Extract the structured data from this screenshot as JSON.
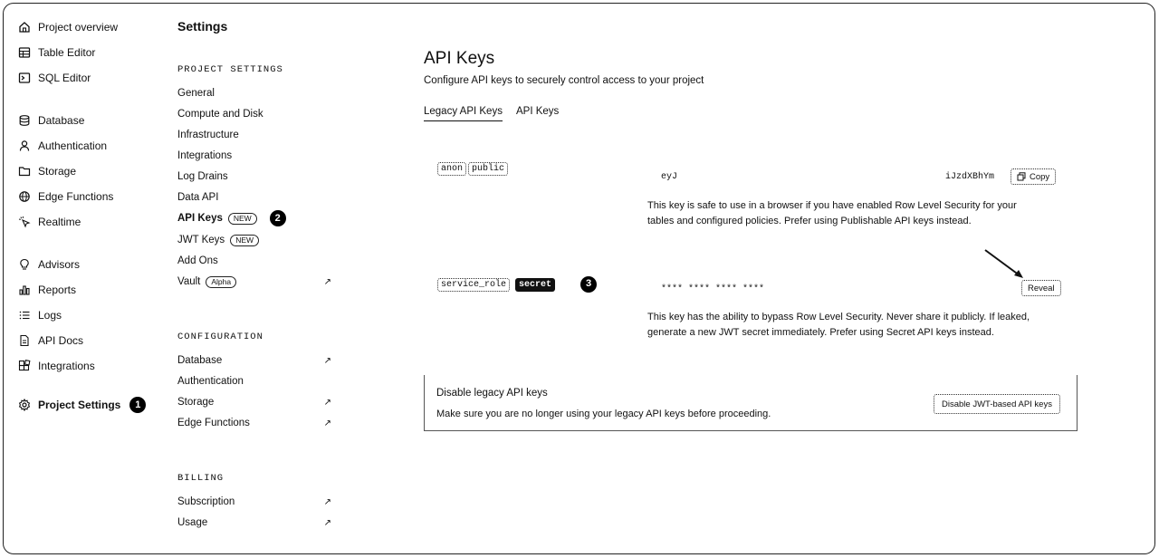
{
  "nav": {
    "items": [
      {
        "label": "Project overview"
      },
      {
        "label": "Table Editor"
      },
      {
        "label": "SQL Editor"
      },
      {
        "label": "Database"
      },
      {
        "label": "Authentication"
      },
      {
        "label": "Storage"
      },
      {
        "label": "Edge Functions"
      },
      {
        "label": "Realtime"
      },
      {
        "label": "Advisors"
      },
      {
        "label": "Reports"
      },
      {
        "label": "Logs"
      },
      {
        "label": "API Docs"
      },
      {
        "label": "Integrations"
      },
      {
        "label": "Project Settings"
      }
    ]
  },
  "markers": {
    "one": "1",
    "two": "2",
    "three": "3"
  },
  "settings": {
    "title": "Settings",
    "project_head": "PROJECT SETTINGS",
    "project_items": [
      {
        "label": "General"
      },
      {
        "label": "Compute and Disk"
      },
      {
        "label": "Infrastructure"
      },
      {
        "label": "Integrations"
      },
      {
        "label": "Log Drains"
      },
      {
        "label": "Data API"
      },
      {
        "label": "API Keys",
        "badge": "NEW"
      },
      {
        "label": "JWT Keys",
        "badge": "NEW"
      },
      {
        "label": "Add Ons"
      },
      {
        "label": "Vault",
        "badge": "Alpha"
      }
    ],
    "config_head": "CONFIGURATION",
    "config_items": [
      {
        "label": "Database"
      },
      {
        "label": "Authentication"
      },
      {
        "label": "Storage"
      },
      {
        "label": "Edge Functions"
      }
    ],
    "billing_head": "BILLING",
    "billing_items": [
      {
        "label": "Subscription"
      },
      {
        "label": "Usage"
      }
    ],
    "ext_glyph": "↗"
  },
  "main": {
    "title": "API Keys",
    "subtitle": "Configure API keys to securely control access to your project",
    "tabs": [
      {
        "label": "Legacy API Keys"
      },
      {
        "label": "API Keys"
      }
    ],
    "anon": {
      "chip1": "anon",
      "chip2": "public",
      "key_start": "eyJ",
      "key_end": "iJzdXBhYm",
      "copy_label": "Copy",
      "desc": "This key is safe to use in a browser if you have enabled Row Level Security for your tables and configured policies. Prefer using Publishable API keys instead."
    },
    "service": {
      "chip1": "service_role",
      "chip2": "secret",
      "masked": "**** **** **** ****",
      "reveal_label": "Reveal",
      "desc": "This key has the ability to bypass Row Level Security. Never share it publicly. If leaked, generate a new JWT secret immediately. Prefer using Secret API keys instead."
    },
    "legacy": {
      "title": "Disable legacy API keys",
      "desc": "Make sure you are no longer using your legacy API keys before proceeding.",
      "button": "Disable JWT-based API keys"
    }
  }
}
